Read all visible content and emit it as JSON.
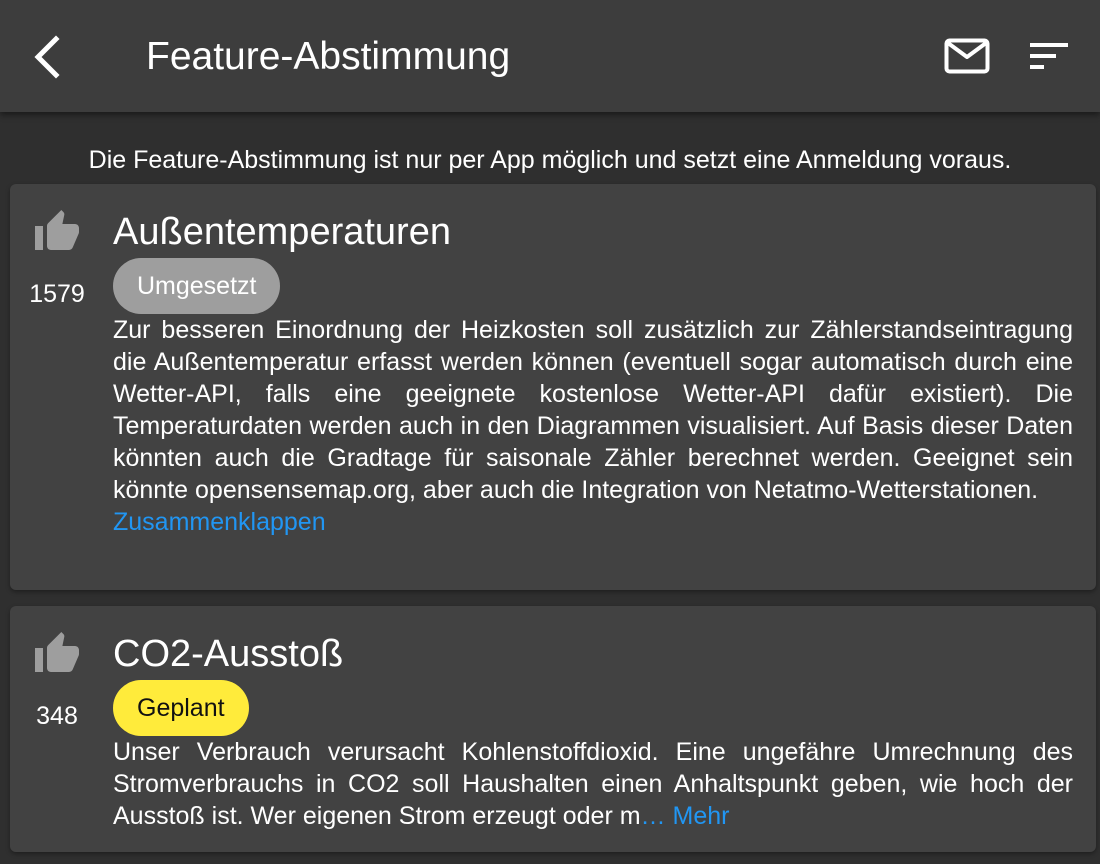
{
  "appbar": {
    "title": "Feature-Abstimmung",
    "back_icon": "back-arrow-icon",
    "mail_icon": "mail-icon",
    "sort_icon": "sort-icon"
  },
  "notice": "Die Feature-Abstimmung ist nur per App möglich und setzt eine Anmeldung voraus.",
  "colors": {
    "background": "#2f2f2f",
    "appbar": "#3d3d3d",
    "card": "#424242",
    "link": "#2196f3",
    "badge_done": "#9e9e9e",
    "badge_planned": "#ffeb3b",
    "thumb": "#9e9e9e"
  },
  "features": [
    {
      "votes": "1579",
      "title": "Außentemperaturen",
      "status": "Umgesetzt",
      "description": "Zur besseren Einordnung der Heizkosten soll zusätzlich zur Zählerstandseintragung die Außentemperatur erfasst werden können (eventuell sogar automatisch durch eine Wetter-API, falls eine geeignete kostenlose Wetter-API dafür existiert). Die Temperaturdaten werden auch in den Diagrammen visualisiert. Auf Basis dieser Daten könnten auch die Gradtage für saisonale Zähler berechnet werden. Geeignet sein könnte opensensemap.org, aber auch die Integration von Netatmo-Wetterstationen.",
      "toggle_label": "Zusammenklappen"
    },
    {
      "votes": "348",
      "title": "CO2-Ausstoß",
      "status": "Geplant",
      "description": "Unser Verbrauch verursacht Kohlenstoffdioxid. Eine ungefähre Umrechnung des Stromverbrauchs in CO2 soll Haushalten einen Anhaltspunkt geben, wie hoch der Ausstoß ist. Wer eigenen Strom erzeugt oder m",
      "toggle_label": "… Mehr"
    }
  ]
}
